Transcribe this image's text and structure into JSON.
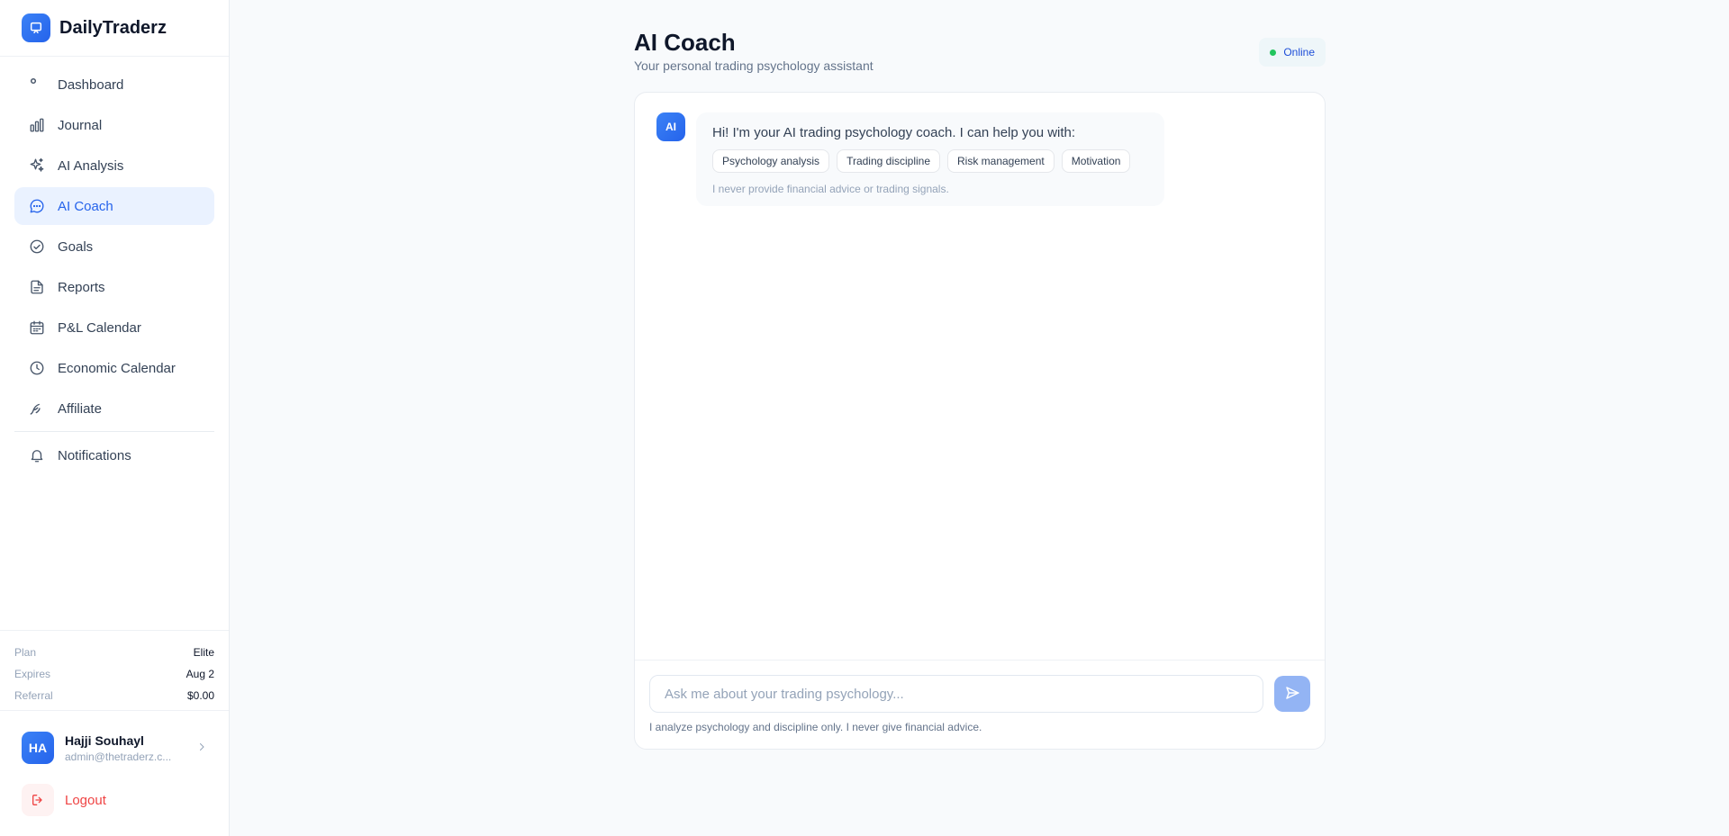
{
  "brand": {
    "name": "DailyTraderz",
    "icon": "monitor-icon"
  },
  "sidebar": {
    "items": [
      {
        "label": "Dashboard",
        "icon": "dot-icon",
        "active": false
      },
      {
        "label": "Journal",
        "icon": "bar-chart-icon",
        "active": false
      },
      {
        "label": "AI Analysis",
        "icon": "sparkles-icon",
        "active": false
      },
      {
        "label": "AI Coach",
        "icon": "chat-bubble-icon",
        "active": true
      },
      {
        "label": "Goals",
        "icon": "check-circle-icon",
        "active": false
      },
      {
        "label": "Reports",
        "icon": "document-icon",
        "active": false
      },
      {
        "label": "P&L Calendar",
        "icon": "calendar-icon",
        "active": false
      },
      {
        "label": "Economic Calendar",
        "icon": "clock-icon",
        "active": false
      },
      {
        "label": "Affiliate",
        "icon": "handshake-icon",
        "active": false
      }
    ],
    "notifications": {
      "label": "Notifications",
      "icon": "bell-icon"
    }
  },
  "plan": {
    "plan_label": "Plan",
    "plan_value": "Elite",
    "expires_label": "Expires",
    "expires_value": "Aug 2",
    "referral_label": "Referral",
    "referral_value": "$0.00"
  },
  "user": {
    "initials": "HA",
    "name": "Hajji Souhayl",
    "email": "admin@thetraderz.c...",
    "logout_label": "Logout"
  },
  "page": {
    "title": "AI Coach",
    "subtitle": "Your personal trading psychology assistant",
    "status": "Online"
  },
  "chat": {
    "ai_avatar": "AI",
    "greeting": "Hi! I'm your AI trading psychology coach. I can help you with:",
    "chips": [
      "Psychology analysis",
      "Trading discipline",
      "Risk management",
      "Motivation"
    ],
    "disclaimer": "I never provide financial advice or trading signals.",
    "input_placeholder": "Ask me about your trading psychology...",
    "input_value": "",
    "footer_note": "I analyze psychology and discipline only. I never give financial advice."
  },
  "colors": {
    "accent": "#2563eb",
    "active_bg": "#eaf2ff",
    "online": "#22c55e",
    "logout": "#ef4444",
    "send_disabled": "#93b4f4"
  }
}
